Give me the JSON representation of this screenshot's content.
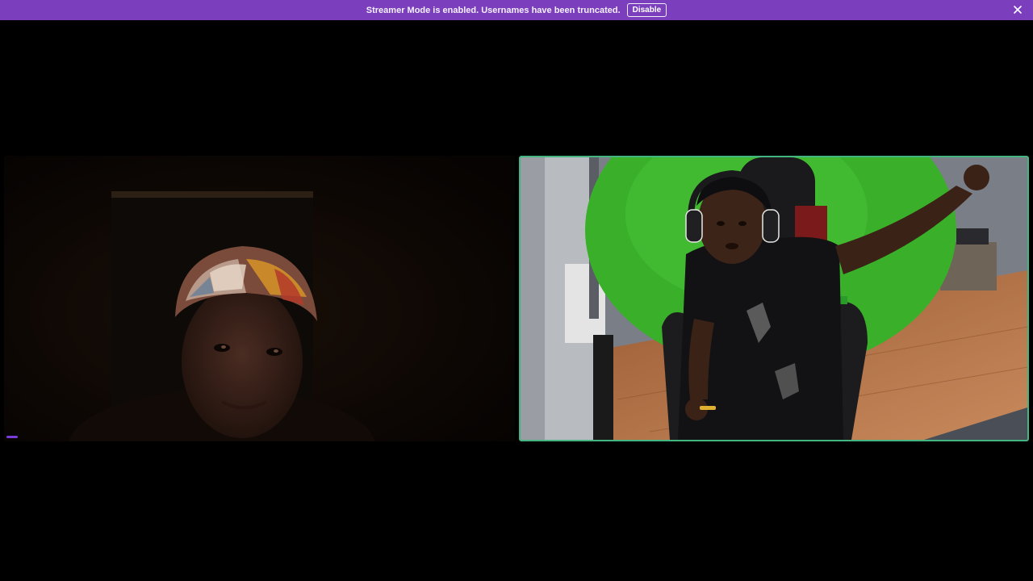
{
  "banner": {
    "message": "Streamer Mode is enabled. Usernames have been truncated.",
    "disable_label": "Disable",
    "close_icon": "close-icon",
    "color": "#7b3fbe"
  },
  "call": {
    "participants": [
      {
        "tile": "left",
        "speaking": false
      },
      {
        "tile": "right",
        "speaking": true,
        "speaking_ring_color": "#43b581"
      }
    ]
  }
}
